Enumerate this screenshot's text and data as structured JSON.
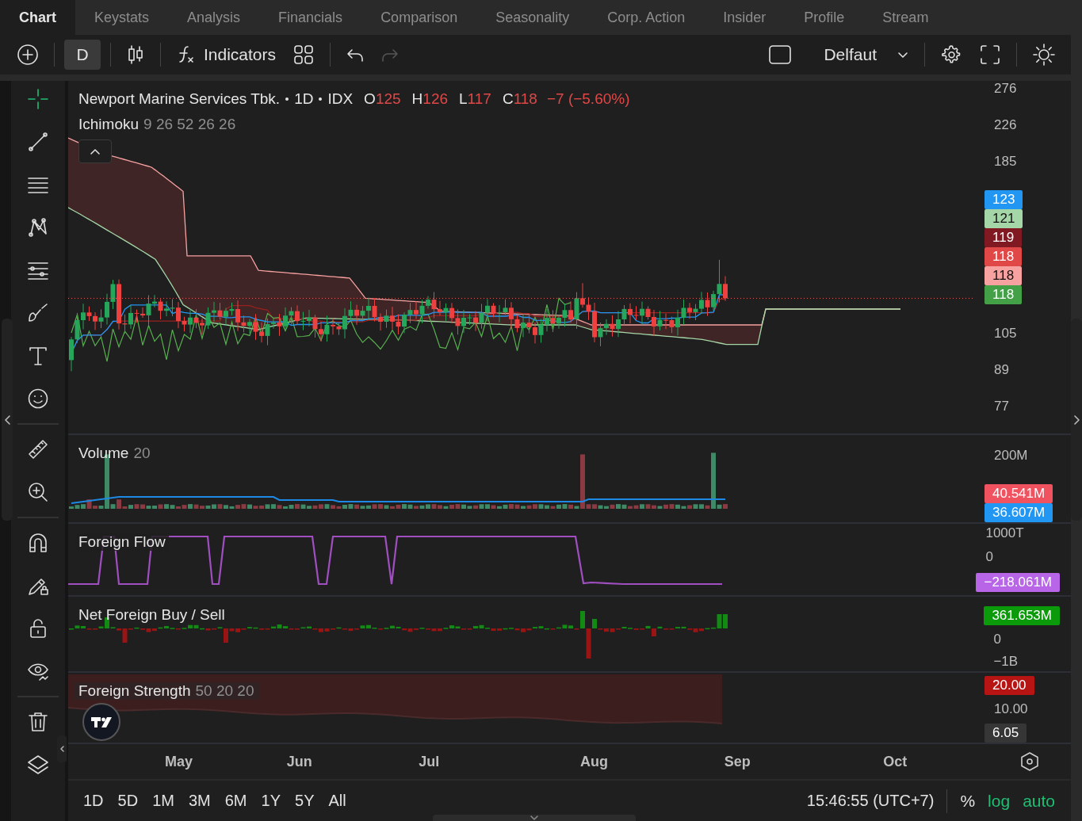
{
  "tabs": [
    {
      "label": "Chart",
      "selected": true
    },
    {
      "label": "Keystats",
      "selected": false
    },
    {
      "label": "Analysis",
      "selected": false
    },
    {
      "label": "Financials",
      "selected": false
    },
    {
      "label": "Comparison",
      "selected": false
    },
    {
      "label": "Seasonality",
      "selected": false
    },
    {
      "label": "Corp. Action",
      "selected": false
    },
    {
      "label": "Insider",
      "selected": false
    },
    {
      "label": "Profile",
      "selected": false
    },
    {
      "label": "Stream",
      "selected": false
    }
  ],
  "toolbar": {
    "interval": {
      "label": "D",
      "selected": true
    },
    "indicators": "Indicators",
    "template": "Delfaut",
    "redo_disabled": true
  },
  "tools": [
    {
      "selected": true
    },
    {
      "selected": false
    },
    {
      "selected": false
    },
    {
      "selected": false
    },
    {
      "selected": false
    },
    {
      "selected": false
    },
    {
      "selected": false
    },
    {
      "selected": false
    },
    {
      "selected": false
    },
    {
      "selected": false
    },
    {
      "selected": false
    },
    {
      "selected": false
    },
    {
      "selected": false
    },
    {
      "selected": false
    },
    {
      "selected": false
    },
    {
      "selected": false
    }
  ],
  "legend": {
    "symbol": "Newport Marine Services Tbk.",
    "interval": "1D",
    "exchange": "IDX",
    "ohlc": [
      {
        "key": "O",
        "value": "125"
      },
      {
        "key": "H",
        "value": "126"
      },
      {
        "key": "L",
        "value": "117"
      },
      {
        "key": "C",
        "value": "118"
      }
    ],
    "change": "−7 (−5.60%)"
  },
  "panes": [
    {
      "kind": "candles",
      "title": "Ichimoku",
      "params": "9 26 52 26 26",
      "axis": [
        {
          "kind": "tick",
          "text": "276"
        },
        {
          "kind": "tick",
          "text": "226"
        },
        {
          "kind": "tick",
          "text": "185"
        },
        {
          "kind": "badge",
          "text": "123",
          "color": "#2196f3"
        },
        {
          "kind": "badge",
          "text": "121",
          "color": "#a5d6a7"
        },
        {
          "kind": "badge",
          "text": "119",
          "color": "#801922"
        },
        {
          "kind": "badge",
          "text": "118",
          "color": "#e04848"
        },
        {
          "kind": "badge",
          "text": "118",
          "color": "#f7a1a1"
        },
        {
          "kind": "badge",
          "text": "118",
          "color": "#43a047"
        },
        {
          "kind": "tick",
          "text": "105"
        },
        {
          "kind": "tick",
          "text": "89"
        },
        {
          "kind": "tick",
          "text": "77"
        }
      ]
    },
    {
      "kind": "volume",
      "title": "Volume",
      "params": "20",
      "axis": [
        {
          "kind": "tick",
          "text": "200M"
        },
        {
          "kind": "badge",
          "text": "40.541M",
          "color": "#f0525f"
        },
        {
          "kind": "badge",
          "text": "36.607M",
          "color": "#2196f3"
        }
      ]
    },
    {
      "kind": "flow",
      "title": "Foreign Flow",
      "axis": [
        {
          "kind": "tick",
          "text": "1000T"
        },
        {
          "kind": "tick",
          "text": "0"
        },
        {
          "kind": "badge",
          "text": "−218.061M",
          "color": "#b865e8"
        }
      ]
    },
    {
      "kind": "histogram",
      "title": "Net Foreign Buy / Sell",
      "axis": [
        {
          "kind": "badge",
          "text": "361.653M",
          "color": "#0a9a0a"
        },
        {
          "kind": "tick",
          "text": "0"
        },
        {
          "kind": "tick",
          "text": "−1B"
        }
      ]
    },
    {
      "kind": "area",
      "title": "Foreign Strength",
      "params": "50 20 20",
      "axis": [
        {
          "kind": "badge",
          "text": "20.00",
          "color": "#b71414"
        },
        {
          "kind": "tick",
          "text": "10.00"
        },
        {
          "kind": "badge",
          "text": "6.05",
          "color": "#363636"
        }
      ]
    }
  ],
  "time_axis": [
    "May",
    "Jun",
    "Jul",
    "Aug",
    "Sep",
    "Oct"
  ],
  "ranges": [
    "1D",
    "5D",
    "1M",
    "3M",
    "6M",
    "1Y",
    "5Y",
    "All"
  ],
  "clock": "15:46:55 (UTC+7)",
  "scale_buttons": [
    {
      "label": "%",
      "on": false
    },
    {
      "label": "log",
      "on": true
    },
    {
      "label": "auto",
      "on": true
    }
  ]
}
